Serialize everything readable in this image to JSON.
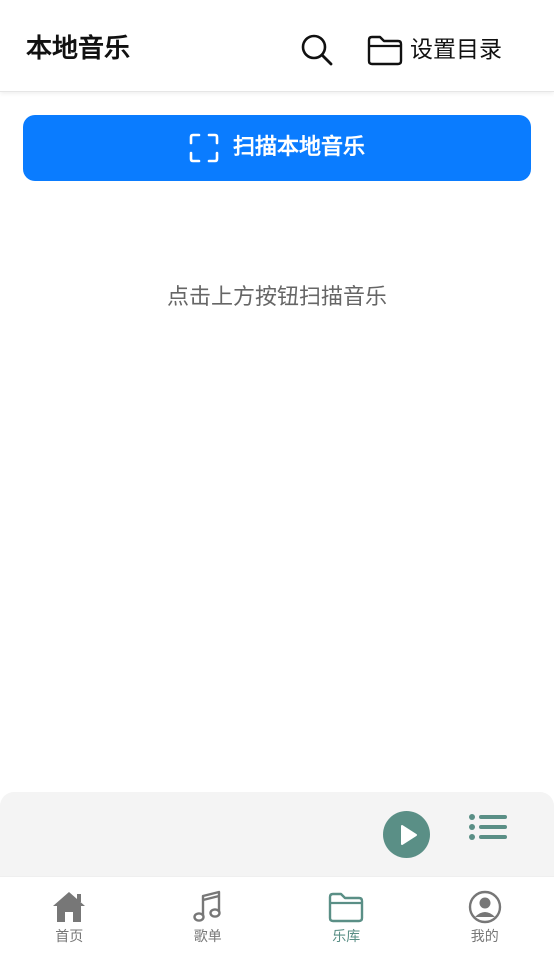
{
  "header": {
    "title": "本地音乐",
    "set_dir_label": "设置目录"
  },
  "scan": {
    "label": "扫描本地音乐"
  },
  "empty_hint": "点击上方按钮扫描音乐",
  "nav": {
    "items": [
      {
        "label": "首页",
        "icon": "home-icon"
      },
      {
        "label": "歌单",
        "icon": "music-note-icon"
      },
      {
        "label": "乐库",
        "icon": "folder-icon",
        "active": true
      },
      {
        "label": "我的",
        "icon": "user-icon"
      }
    ]
  },
  "colors": {
    "accent": "#0a7cff",
    "player_accent": "#5a8f86",
    "nav_inactive": "#777777"
  }
}
